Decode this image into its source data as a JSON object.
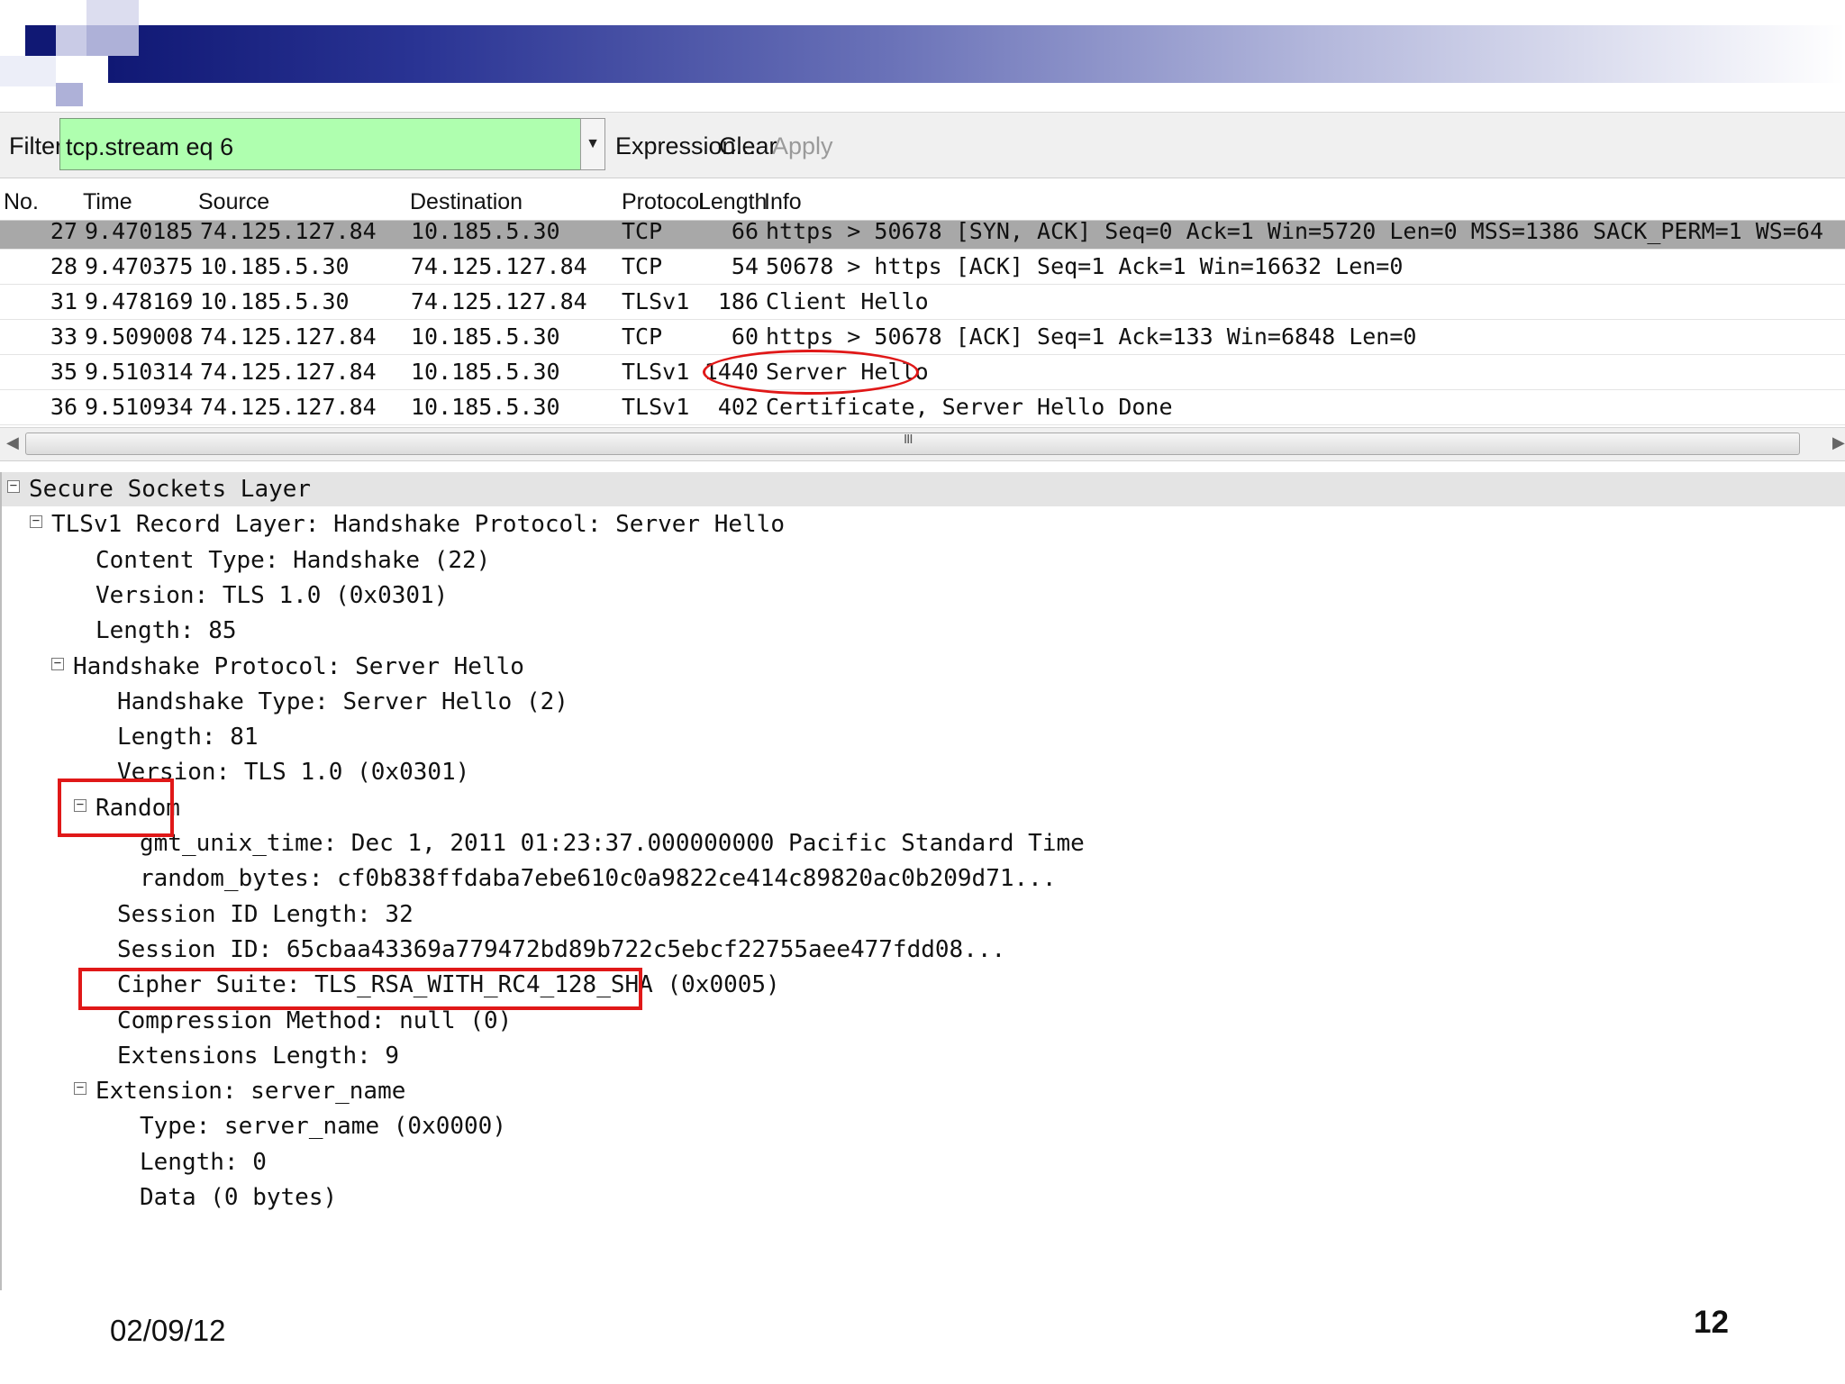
{
  "filter": {
    "label": "Filter:",
    "value": "tcp.stream eq 6",
    "expression_label": "Expression...",
    "clear_label": "Clear",
    "apply_label": "Apply"
  },
  "columns": [
    "No.",
    "Time",
    "Source",
    "Destination",
    "Protocol",
    "Length",
    "Info"
  ],
  "packets": [
    {
      "no": "27",
      "time": "9.470185",
      "src": "74.125.127.84",
      "dst": "10.185.5.30",
      "proto": "TCP",
      "len": "66",
      "info": "https > 50678 [SYN, ACK] Seq=0 Ack=1 Win=5720 Len=0 MSS=1386 SACK_PERM=1 WS=64"
    },
    {
      "no": "28",
      "time": "9.470375",
      "src": "10.185.5.30",
      "dst": "74.125.127.84",
      "proto": "TCP",
      "len": "54",
      "info": "50678 > https [ACK] Seq=1 Ack=1 Win=16632 Len=0"
    },
    {
      "no": "31",
      "time": "9.478169",
      "src": "10.185.5.30",
      "dst": "74.125.127.84",
      "proto": "TLSv1",
      "len": "186",
      "info": "Client Hello"
    },
    {
      "no": "33",
      "time": "9.509008",
      "src": "74.125.127.84",
      "dst": "10.185.5.30",
      "proto": "TCP",
      "len": "60",
      "info": "https > 50678 [ACK] Seq=1 Ack=133 Win=6848 Len=0"
    },
    {
      "no": "35",
      "time": "9.510314",
      "src": "74.125.127.84",
      "dst": "10.185.5.30",
      "proto": "TLSv1",
      "len": "1440",
      "info": "Server Hello"
    },
    {
      "no": "36",
      "time": "9.510934",
      "src": "74.125.127.84",
      "dst": "10.185.5.30",
      "proto": "TLSv1",
      "len": "402",
      "info": "Certificate, Server Hello Done"
    }
  ],
  "scrollbar": {
    "grip": "III"
  },
  "details": [
    {
      "text": "Secure Sockets Layer",
      "level": 0,
      "expander": true
    },
    {
      "text": "TLSv1 Record Layer: Handshake Protocol: Server Hello",
      "level": 1,
      "expander": true
    },
    {
      "text": "Content Type: Handshake (22)",
      "level": 3,
      "expander": false
    },
    {
      "text": "Version: TLS 1.0 (0x0301)",
      "level": 3,
      "expander": false
    },
    {
      "text": "Length: 85",
      "level": 3,
      "expander": false
    },
    {
      "text": "Handshake Protocol: Server Hello",
      "level": 2,
      "expander": true
    },
    {
      "text": "Handshake Type: Server Hello (2)",
      "level": 4,
      "expander": false
    },
    {
      "text": "Length: 81",
      "level": 4,
      "expander": false
    },
    {
      "text": "Version: TLS 1.0 (0x0301)",
      "level": 4,
      "expander": false
    },
    {
      "text": "Random",
      "level": 3,
      "expander": true
    },
    {
      "text": "gmt_unix_time: Dec  1, 2011 01:23:37.000000000 Pacific Standard Time",
      "level": 5,
      "expander": false
    },
    {
      "text": "random_bytes: cf0b838ffdaba7ebe610c0a9822ce414c89820ac0b209d71...",
      "level": 5,
      "expander": false
    },
    {
      "text": "Session ID Length: 32",
      "level": 4,
      "expander": false
    },
    {
      "text": "Session ID: 65cbaa43369a779472bd89b722c5ebcf22755aee477fdd08...",
      "level": 4,
      "expander": false
    },
    {
      "text": "Cipher Suite: TLS_RSA_WITH_RC4_128_SHA (0x0005)",
      "level": 4,
      "expander": false
    },
    {
      "text": "Compression Method: null (0)",
      "level": 4,
      "expander": false
    },
    {
      "text": "Extensions Length: 9",
      "level": 4,
      "expander": false
    },
    {
      "text": "Extension: server_name",
      "level": 3,
      "expander": true
    },
    {
      "text": "Type: server_name (0x0000)",
      "level": 5,
      "expander": false
    },
    {
      "text": "Length: 0",
      "level": 5,
      "expander": false
    },
    {
      "text": "Data (0 bytes)",
      "level": 5,
      "expander": false
    }
  ],
  "slide": {
    "date": "02/09/12",
    "page": "12"
  },
  "colors": {
    "filter_bg": "#afffaf",
    "selected_row": "#a8a8a8",
    "annotation": "#e01818",
    "banner_dark": "#101874"
  }
}
